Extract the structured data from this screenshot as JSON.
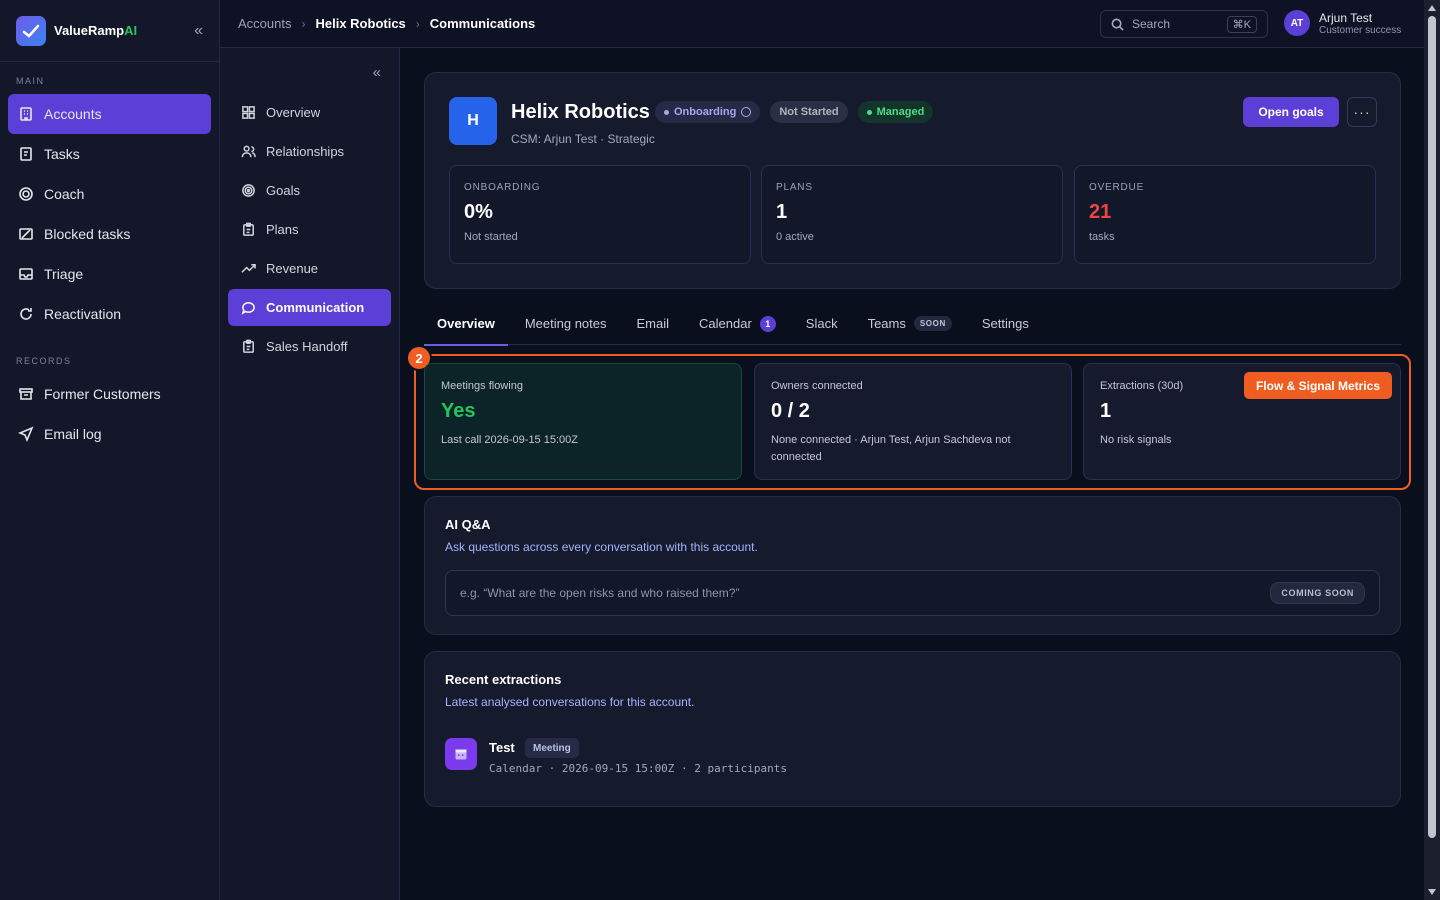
{
  "brand": {
    "name_main": "ValueRamp",
    "name_ai": "AI"
  },
  "sidebar": {
    "main_label": "MAIN",
    "records_label": "RECORDS",
    "main_items": [
      {
        "label": "Accounts",
        "icon": "building-icon"
      },
      {
        "label": "Tasks",
        "icon": "clipboard-icon"
      },
      {
        "label": "Coach",
        "icon": "target-icon"
      },
      {
        "label": "Blocked tasks",
        "icon": "blocked-icon"
      },
      {
        "label": "Triage",
        "icon": "inbox-icon"
      },
      {
        "label": "Reactivation",
        "icon": "refresh-icon"
      }
    ],
    "record_items": [
      {
        "label": "Former Customers",
        "icon": "archive-icon"
      },
      {
        "label": "Email log",
        "icon": "send-icon"
      }
    ]
  },
  "subnav": {
    "items": [
      {
        "label": "Overview",
        "icon": "grid-icon"
      },
      {
        "label": "Relationships",
        "icon": "users-icon"
      },
      {
        "label": "Goals",
        "icon": "goal-icon"
      },
      {
        "label": "Plans",
        "icon": "clipboard-icon"
      },
      {
        "label": "Revenue",
        "icon": "trend-icon"
      },
      {
        "label": "Communication",
        "icon": "chat-icon"
      },
      {
        "label": "Sales Handoff",
        "icon": "clipboard-icon"
      }
    ]
  },
  "breadcrumb": [
    "Accounts",
    "Helix Robotics",
    "Communications"
  ],
  "search": {
    "label": "Search",
    "shortcut": "⌘K"
  },
  "user": {
    "initials": "AT",
    "name": "Arjun Test",
    "role": "Customer success"
  },
  "account": {
    "initial": "H",
    "name": "Helix Robotics",
    "badge_onboarding": "Onboarding",
    "badge_status": "Not Started",
    "badge_managed": "Managed",
    "subtitle": "CSM: Arjun Test · Strategic",
    "open_goals": "Open goals",
    "more": "···"
  },
  "stats": [
    {
      "label": "ONBOARDING",
      "value": "0%",
      "sub": "Not started"
    },
    {
      "label": "PLANS",
      "value": "1",
      "sub": "0 active"
    },
    {
      "label": "OVERDUE",
      "value": "21",
      "sub": "tasks"
    }
  ],
  "tabs": [
    {
      "label": "Overview"
    },
    {
      "label": "Meeting notes"
    },
    {
      "label": "Email"
    },
    {
      "label": "Calendar",
      "count": "1"
    },
    {
      "label": "Slack"
    },
    {
      "label": "Teams",
      "tag": "SOON"
    },
    {
      "label": "Settings"
    }
  ],
  "highlight_number": "2",
  "metrics": [
    {
      "label": "Meetings flowing",
      "value": "Yes",
      "sub": "Last call 2026-09-15 15:00Z"
    },
    {
      "label": "Owners connected",
      "value": "0 / 2",
      "sub": "None connected · Arjun Test, Arjun Sachdeva not connected"
    },
    {
      "label": "Extractions (30d)",
      "value": "1",
      "sub": "No risk signals",
      "button": "Flow & Signal Metrics"
    }
  ],
  "qa": {
    "title": "AI Q&A",
    "subtitle": "Ask questions across every conversation with this account.",
    "placeholder": "e.g. “What are the open risks and who raised them?”",
    "coming_soon": "COMING SOON"
  },
  "recent": {
    "title": "Recent extractions",
    "subtitle": "Latest analysed conversations for this account.",
    "item_name": "Test",
    "item_badge": "Meeting",
    "item_meta": "Calendar · 2026-09-15 15:00Z · 2 participants"
  },
  "colors": {
    "accent": "#5b3fd6",
    "highlight": "#f05d22",
    "success": "#22c55e",
    "danger": "#ef4444"
  }
}
